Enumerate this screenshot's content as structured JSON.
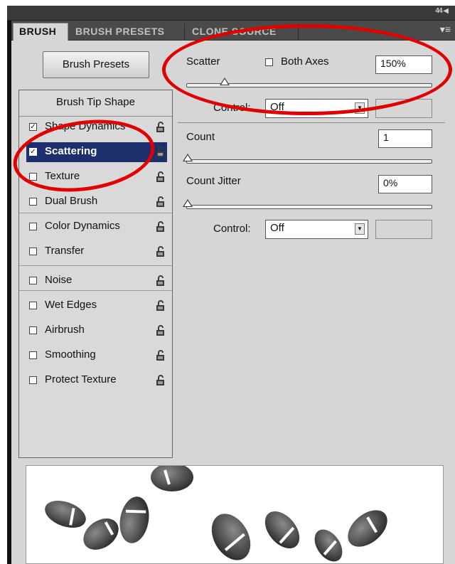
{
  "tabs": [
    {
      "label": "BRUSH",
      "active": true
    },
    {
      "label": "BRUSH PRESETS",
      "active": false
    },
    {
      "label": "CLONE SOURCE",
      "active": false
    }
  ],
  "collapse_label": "44",
  "brush_presets_button": "Brush Presets",
  "list": {
    "header": "Brush Tip Shape",
    "items": [
      {
        "label": "Shape Dynamics",
        "checked": true
      },
      {
        "label": "Scattering",
        "checked": true,
        "selected": true
      },
      {
        "label": "Texture",
        "checked": false
      },
      {
        "label": "Dual Brush",
        "checked": false
      },
      {
        "label": "Color Dynamics",
        "checked": false
      },
      {
        "label": "Transfer",
        "checked": false
      },
      {
        "label": "Noise",
        "checked": false
      },
      {
        "label": "Wet Edges",
        "checked": false
      },
      {
        "label": "Airbrush",
        "checked": false
      },
      {
        "label": "Smoothing",
        "checked": false
      },
      {
        "label": "Protect Texture",
        "checked": false
      }
    ]
  },
  "scatter": {
    "label": "Scatter",
    "both_axes_label": "Both Axes",
    "value": "150%",
    "control_label": "Control:",
    "control_value": "Off"
  },
  "count": {
    "label": "Count",
    "value": "1"
  },
  "count_jitter": {
    "label": "Count Jitter",
    "value": "0%",
    "control_label": "Control:",
    "control_value": "Off"
  },
  "colors": {
    "highlight": "#1e2f6e",
    "annotation": "#e00000",
    "panel": "#d6d6d6"
  }
}
